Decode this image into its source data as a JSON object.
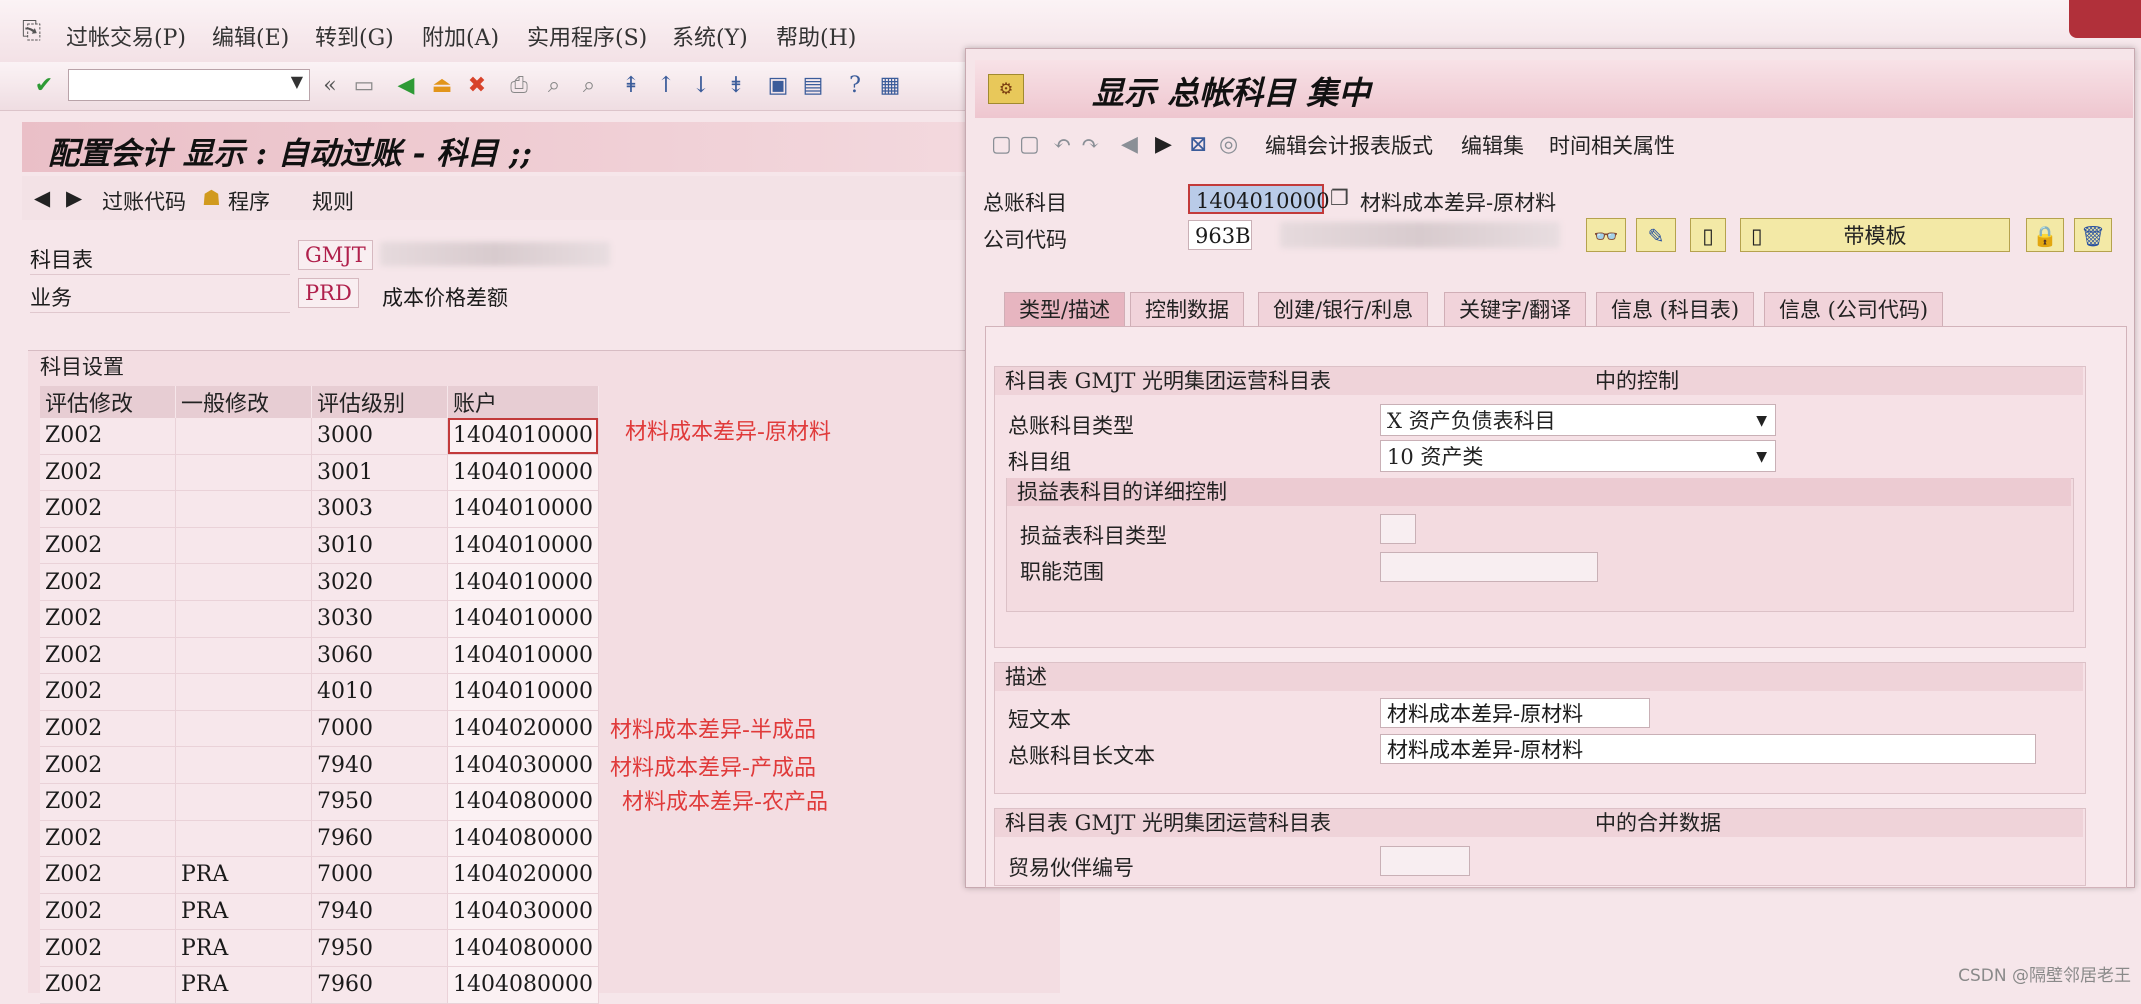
{
  "menu": {
    "items": [
      "过帐交易(P)",
      "编辑(E)",
      "转到(G)",
      "附加(A)",
      "实用程序(S)",
      "系统(Y)",
      "帮助(H)"
    ]
  },
  "left": {
    "title": "配置会计 显示 : 自动过账 - 科目 ;;",
    "toolbar": {
      "posting_code": "过账代码",
      "program": "程序",
      "rules": "规则"
    },
    "fields": [
      {
        "label": "科目表",
        "value": "GMJT"
      },
      {
        "label": "业务",
        "value": "PRD",
        "text": "成本价格差额"
      }
    ],
    "group_title": "科目设置",
    "table": {
      "headers": [
        "评估修改",
        "一般修改",
        "评估级别",
        "账户"
      ],
      "rows": [
        [
          "Z002",
          "",
          "3000",
          "1404010000"
        ],
        [
          "Z002",
          "",
          "3001",
          "1404010000"
        ],
        [
          "Z002",
          "",
          "3003",
          "1404010000"
        ],
        [
          "Z002",
          "",
          "3010",
          "1404010000"
        ],
        [
          "Z002",
          "",
          "3020",
          "1404010000"
        ],
        [
          "Z002",
          "",
          "3030",
          "1404010000"
        ],
        [
          "Z002",
          "",
          "3060",
          "1404010000"
        ],
        [
          "Z002",
          "",
          "4010",
          "1404010000"
        ],
        [
          "Z002",
          "",
          "7000",
          "1404020000"
        ],
        [
          "Z002",
          "",
          "7940",
          "1404030000"
        ],
        [
          "Z002",
          "",
          "7950",
          "1404080000"
        ],
        [
          "Z002",
          "",
          "7960",
          "1404080000"
        ],
        [
          "Z002",
          "PRA",
          "7000",
          "1404020000"
        ],
        [
          "Z002",
          "PRA",
          "7940",
          "1404030000"
        ],
        [
          "Z002",
          "PRA",
          "7950",
          "1404080000"
        ],
        [
          "Z002",
          "PRA",
          "7960",
          "1404080000"
        ]
      ]
    },
    "notes": [
      "材料成本差异-原材料",
      "材料成本差异-半成品",
      "材料成本差异-产成品",
      "材料成本差异-农产品"
    ]
  },
  "dialog": {
    "title": "显示 总帐科目 集中",
    "toolbar": {
      "edit_layout": "编辑会计报表版式",
      "edit_set": "编辑集",
      "time_attrs": "时间相关属性"
    },
    "account_label": "总账科目",
    "account_value": "1404010000",
    "account_text": "材料成本差异-原材料",
    "company_label": "公司代码",
    "company_value": "963B",
    "template_button": "带模板",
    "tabs": [
      "类型/描述",
      "控制数据",
      "创建/银行/利息",
      "关键字/翻译",
      "信息 (科目表)",
      "信息 (公司代码)"
    ],
    "control_section": {
      "head_left": "科目表 GMJT 光明集团运营科目表",
      "head_right": "中的控制",
      "gl_type_label": "总账科目类型",
      "gl_type_value": "X 资产负债表科目",
      "group_label": "科目组",
      "group_value": "10 资产类",
      "pl_head": "损益表科目的详细控制",
      "pl_type_label": "损益表科目类型",
      "func_area_label": "职能范围"
    },
    "desc_section": {
      "head": "描述",
      "short_label": "短文本",
      "short_value": "材料成本差异-原材料",
      "long_label": "总账科目长文本",
      "long_value": "材料成本差异-原材料"
    },
    "consol_section": {
      "head_left": "科目表 GMJT 光明集团运营科目表",
      "head_right": "中的合并数据",
      "partner_label": "贸易伙伴编号"
    }
  },
  "watermark": "CSDN @隔壁邻居老王"
}
